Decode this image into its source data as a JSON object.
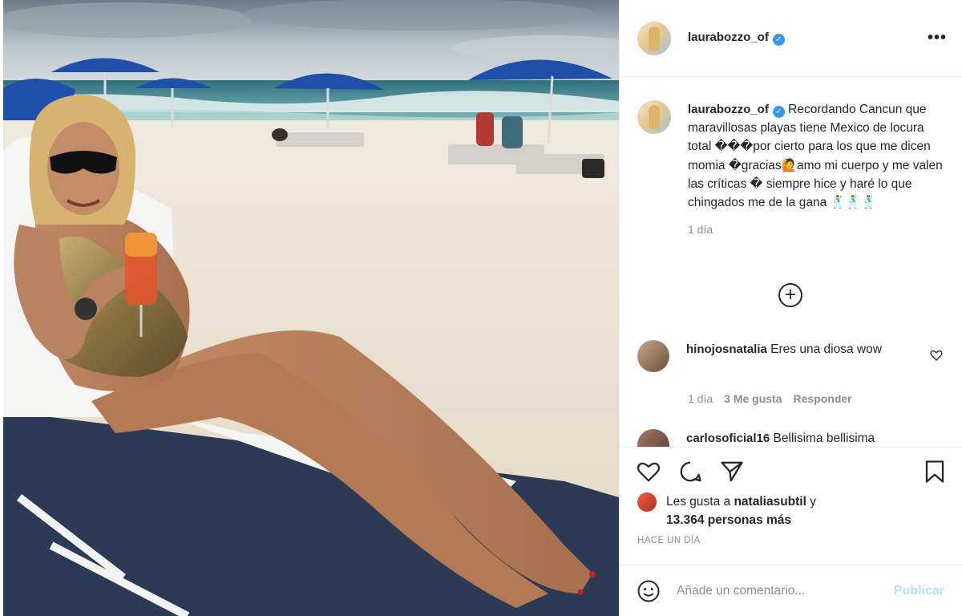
{
  "post": {
    "username": "laurabozzo_of",
    "verified_icon": "verified-badge-icon",
    "more_icon": "more-options-icon",
    "more_label": "•••"
  },
  "caption": {
    "username": "laurabozzo_of",
    "text": "Recordando Cancun que maravillosas playas tiene Mexico de locura total ���por cierto para los que me dicen momia �gracias🙋amo mi cuerpo y me valen las críticas � siempre hice y haré lo que chingados me de la gana 🕺🕺🕺",
    "time": "1 día"
  },
  "load_more_icon": "plus-circle-icon",
  "load_more_label": "+",
  "comments": [
    {
      "username": "hinojosnatalia",
      "text": "Eres una diosa wow",
      "time": "1 día",
      "likes": "3 Me gusta",
      "reply": "Responder"
    },
    {
      "username": "carlosoficial16",
      "text": "Bellisima bellisima"
    }
  ],
  "actions": {
    "like_icon": "heart-icon",
    "comment_icon": "comment-icon",
    "share_icon": "paper-plane-icon",
    "save_icon": "bookmark-icon"
  },
  "likes": {
    "prefix": "Les gusta a",
    "user": "nataliasubtil",
    "middle": "y",
    "count": "13.364 personas más"
  },
  "posted_ago": "HACE UN DÍA",
  "comment_box": {
    "placeholder": "Añade un comentario...",
    "publish_label": "Publicar",
    "publish_color": "#b2dffc",
    "emoji_icon": "smiley-icon"
  },
  "colors": {
    "verified": "#3897f0",
    "muted": "#8e8e8e",
    "text": "#262626"
  }
}
